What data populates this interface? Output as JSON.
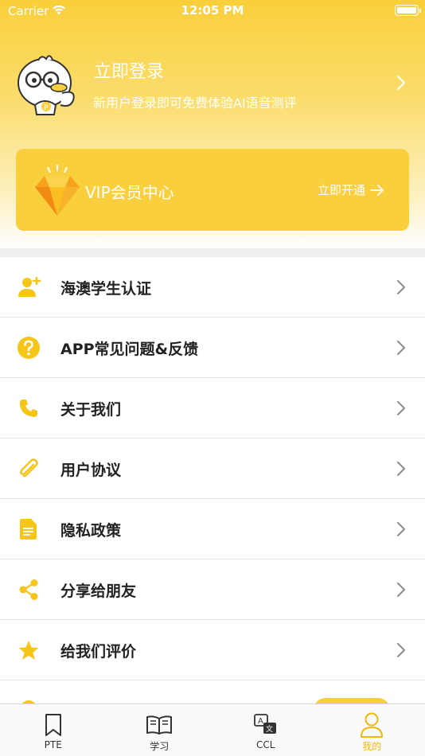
{
  "status_bar": {
    "carrier": "Carrier",
    "time": "12:05 PM"
  },
  "profile": {
    "title": "立即登录",
    "subtitle": "新用户登录即可免费体验AI语音测评",
    "avatar_icon": "duck-mascot-avatar",
    "chevron_icon": "chevron-right-icon"
  },
  "vip": {
    "title": "VIP会员中心",
    "action": "立即开通",
    "icon": "diamond-icon",
    "action_icon": "arrow-right-icon"
  },
  "menu": {
    "items": [
      {
        "label": "海澳学生认证",
        "icon": "add-user-icon"
      },
      {
        "label": "APP常见问题&反馈",
        "icon": "question-circle-icon"
      },
      {
        "label": "关于我们",
        "icon": "phone-icon"
      },
      {
        "label": "用户协议",
        "icon": "paperclip-icon"
      },
      {
        "label": "隐私政策",
        "icon": "document-icon"
      },
      {
        "label": "分享给朋友",
        "icon": "share-icon"
      },
      {
        "label": "给我们评价",
        "icon": "star-icon"
      }
    ]
  },
  "tab_bar": {
    "tabs": [
      {
        "label": "PTE",
        "icon": "bookmark-icon"
      },
      {
        "label": "学习",
        "icon": "book-icon"
      },
      {
        "label": "CCL",
        "icon": "translate-icon"
      },
      {
        "label": "我的",
        "icon": "person-icon"
      }
    ],
    "active": "我的"
  },
  "colors": {
    "accent": "#f9cf3d",
    "icon": "#f5c518",
    "active_tab": "#f2b707",
    "text": "#222222"
  }
}
